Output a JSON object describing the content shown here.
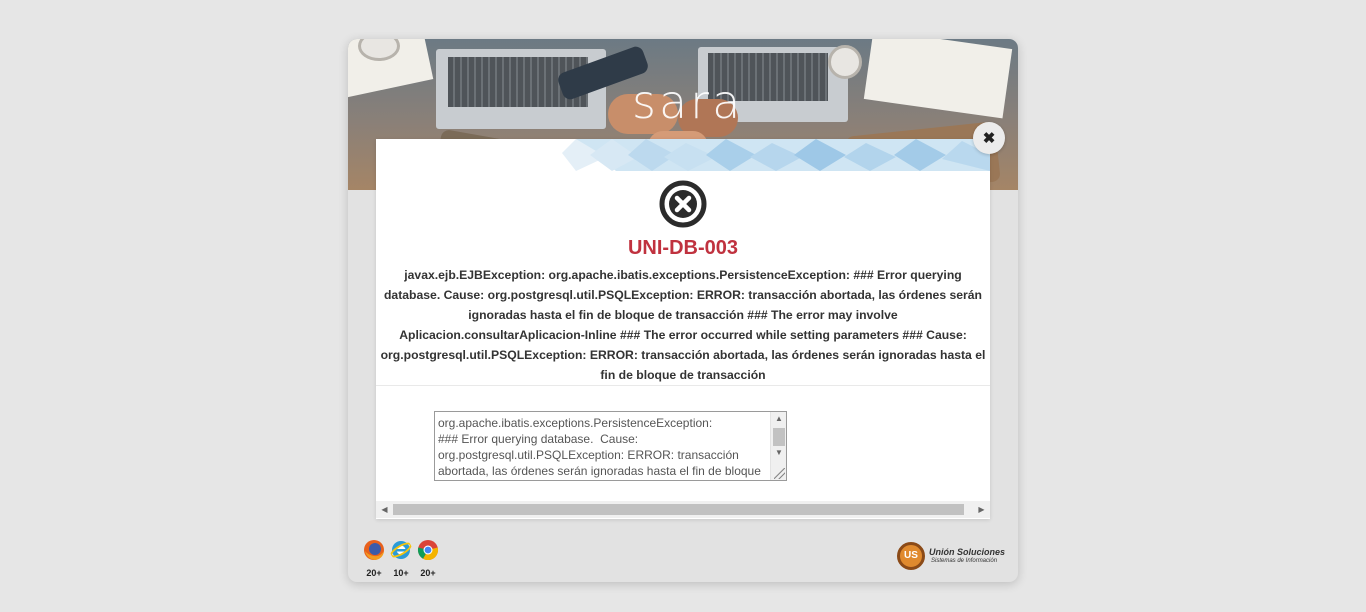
{
  "header": {
    "logo_text": "sara"
  },
  "modal": {
    "close_icon": "close-icon",
    "status_icon": "error-circle-x-icon",
    "error_code": "UNI-DB-003",
    "error_message": "javax.ejb.EJBException: org.apache.ibatis.exceptions.PersistenceException: ### Error querying database. Cause: org.postgresql.util.PSQLException: ERROR: transacción abortada, las órdenes serán ignoradas hasta el fin de bloque de transacción ### The error may involve Aplicacion.consultarAplicacion-Inline ### The error occurred while setting parameters ### Cause: org.postgresql.util.PSQLException: ERROR: transacción abortada, las órdenes serán ignoradas hasta el fin de bloque de transacción",
    "detail_text": "org.apache.ibatis.exceptions.PersistenceException: \n### Error querying database.  Cause: org.postgresql.util.PSQLException: ERROR: transacción abortada, las órdenes serán ignoradas hasta el fin de bloque",
    "accent_color": "#c0323f"
  },
  "footer": {
    "browsers": [
      {
        "name": "firefox-icon",
        "version": "20+"
      },
      {
        "name": "internet-explorer-icon",
        "version": "10+"
      },
      {
        "name": "chrome-icon",
        "version": "20+"
      }
    ],
    "company_name": "Unión Soluciones",
    "company_tagline": "Sistemas de Información"
  }
}
